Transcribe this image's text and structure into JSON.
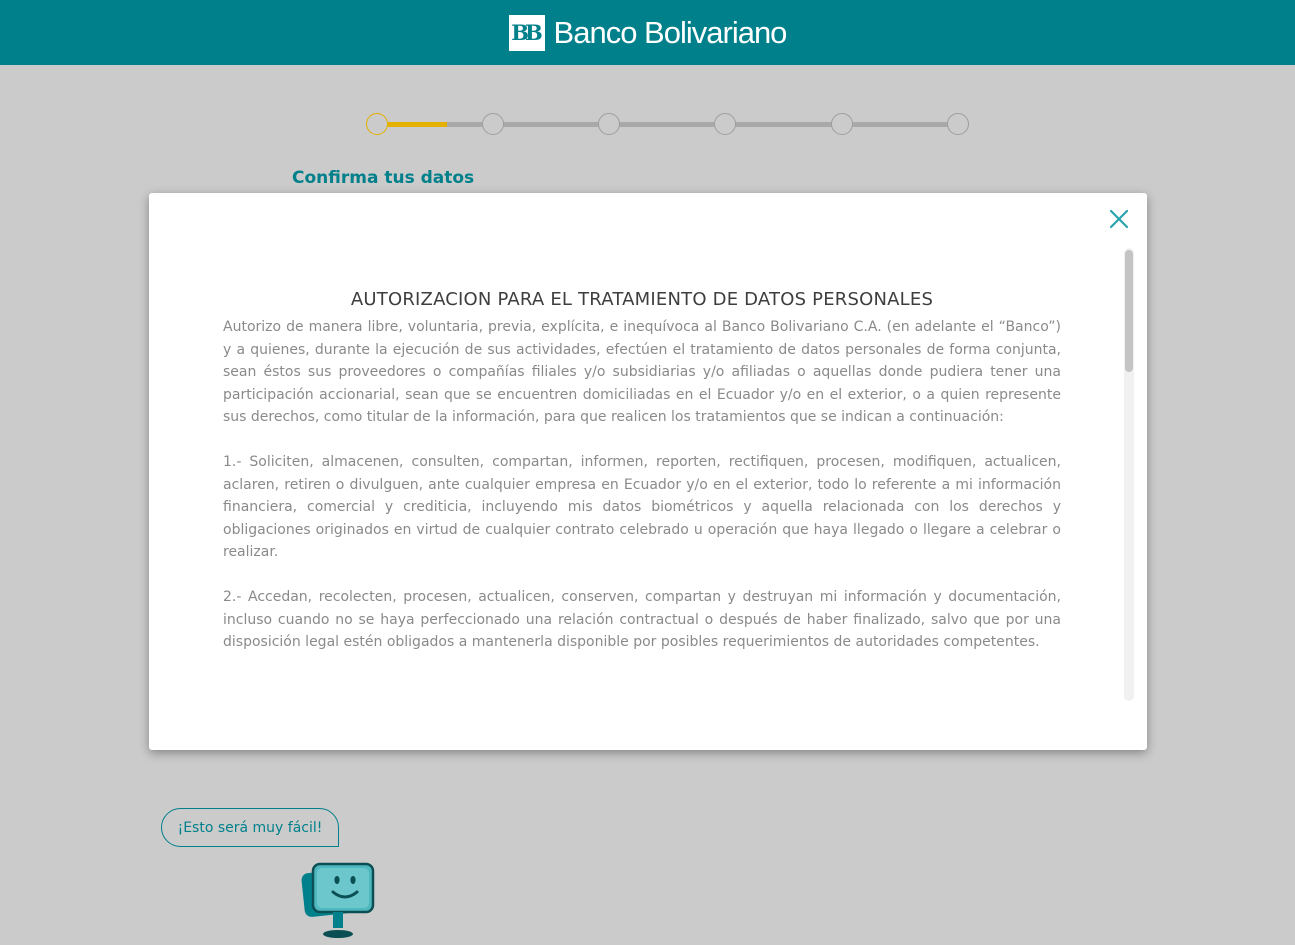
{
  "header": {
    "brand_mark": "BB",
    "brand_name": "Banco Bolivariano"
  },
  "stepper": {
    "total_steps": 6,
    "current_step": 1,
    "progress_fraction": 0.12
  },
  "page": {
    "section_title": "Confirma tus datos"
  },
  "modal": {
    "title": "AUTORIZACION PARA EL TRATAMIENTO DE DATOS PERSONALES",
    "paragraphs": [
      "Autorizo de manera libre, voluntaria, previa, explícita, e inequívoca al Banco Bolivariano C.A. (en adelante el “Banco”) y a quienes, durante la ejecución de sus actividades, efectúen el tratamiento de datos personales de forma conjunta, sean éstos sus proveedores o compañías filiales y/o subsidiarias y/o afiliadas o aquellas donde pudiera tener una participación accionarial, sean que se encuentren domiciliadas en el Ecuador y/o en el exterior, o a quien represente sus derechos, como titular de la información, para que realicen los tratamientos que se indican a continuación:",
      "1.- Soliciten, almacenen, consulten, compartan, informen, reporten, rectifiquen, procesen, modifiquen, actualicen, aclaren, retiren o divulguen, ante cualquier empresa en Ecuador y/o en el exterior, todo lo referente a mi información financiera, comercial y crediticia, incluyendo mis datos biométricos y aquella relacionada con los derechos y obligaciones originados en virtud de cualquier contrato celebrado u operación que haya llegado o llegare a celebrar o realizar.",
      "2.- Accedan, recolecten, procesen, actualicen, conserven, compartan y destruyan mi información y documentación, incluso cuando no se haya perfeccionado una relación contractual o después de haber finalizado, salvo que por una disposición legal estén obligados a mantenerla disponible por posibles requerimientos de autoridades competentes."
    ]
  },
  "helper": {
    "bubble_text": "¡Esto será muy fácil!"
  },
  "colors": {
    "brand": "#00808b",
    "accent": "#e5b100",
    "overlay": "#cbcbcb"
  }
}
